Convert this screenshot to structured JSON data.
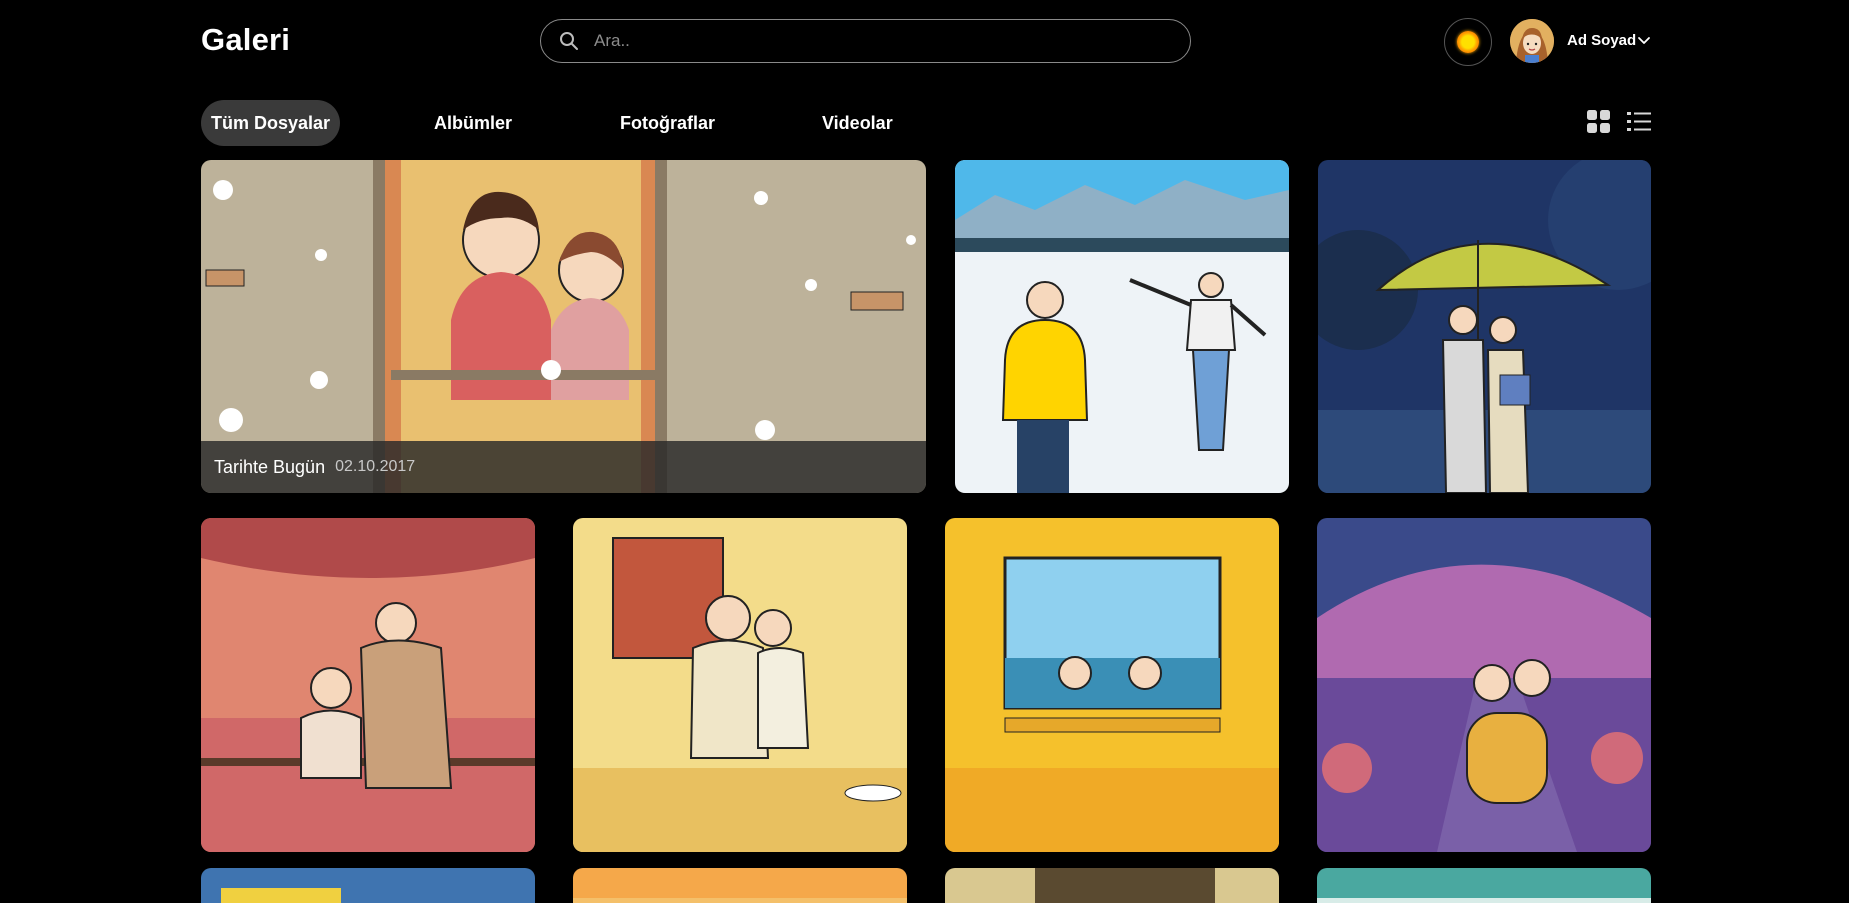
{
  "app": {
    "title": "Galeri"
  },
  "search": {
    "placeholder": "Ara..",
    "value": ""
  },
  "user": {
    "name": "Ad Soyad"
  },
  "tabs": [
    {
      "label": "Tüm Dosyalar",
      "active": true
    },
    {
      "label": "Albümler",
      "active": false
    },
    {
      "label": "Fotoğraflar",
      "active": false
    },
    {
      "label": "Videolar",
      "active": false
    }
  ],
  "featured": {
    "title": "Tarihte Bugün",
    "date": "02.10.2017"
  },
  "colors": {
    "background": "#000000",
    "active_tab": "#3a3a3a",
    "border": "#8a8a8a"
  },
  "icons": [
    "search-icon",
    "sun-icon",
    "chevron-down-icon",
    "grid-view-icon",
    "list-view-icon"
  ]
}
